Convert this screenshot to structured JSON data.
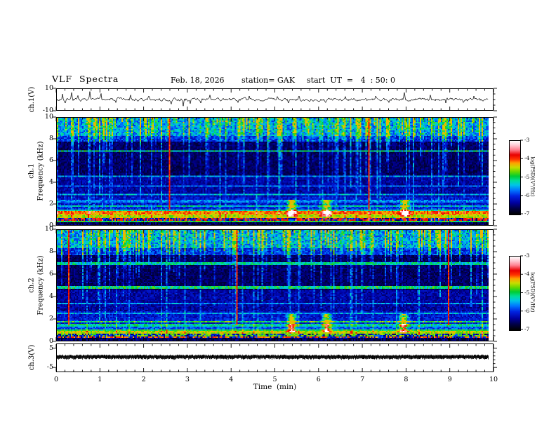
{
  "header": {
    "title": "VLF  Spectra",
    "date": "Feb. 18, 2026",
    "station": "station= GAK",
    "start_ut": "start  UT  =   4  : 50: 0"
  },
  "time_axis": {
    "label": "Time  (min)",
    "tick_labels": [
      "0",
      "1",
      "2",
      "3",
      "4",
      "5",
      "6",
      "7",
      "8",
      "9",
      "10"
    ],
    "range_min": [
      0,
      10
    ],
    "minor_step_min": 0.2
  },
  "panels": {
    "ch1_wave": {
      "ylabel": "ch.1(V)",
      "ytick_labels": [
        "10",
        "-10"
      ],
      "ytick_values": [
        10,
        -10
      ],
      "yrange": [
        -10,
        10
      ]
    },
    "ch1_spec": {
      "ylabel_lines": [
        "ch.1",
        "Frequency  (kHz)"
      ],
      "ytick_labels": [
        "10",
        "8",
        "6",
        "4",
        "2",
        "0"
      ],
      "ytick_values": [
        10,
        8,
        6,
        4,
        2,
        0
      ],
      "yrange_kHz": [
        0,
        10
      ]
    },
    "ch2_spec": {
      "ylabel_lines": [
        "ch.2",
        "Frequency  (kHz)"
      ],
      "ytick_labels": [
        "10",
        "8",
        "6",
        "4",
        "2",
        "0"
      ],
      "ytick_values": [
        10,
        8,
        6,
        4,
        2,
        0
      ],
      "yrange_kHz": [
        0,
        10
      ]
    },
    "ch3_wave": {
      "ylabel": "ch.3(V)",
      "ytick_labels": [
        "5",
        "-5"
      ],
      "ytick_values": [
        5,
        -5
      ],
      "yrange": [
        -7.5,
        7.5
      ]
    }
  },
  "colorbar": {
    "label": "log(PSD)(V²/Hz)",
    "tick_labels": [
      "-3",
      "-4",
      "-5",
      "-6",
      "-7"
    ],
    "range": [
      -3,
      -7
    ]
  },
  "accent_colors": {
    "axis": "#000000",
    "background": "#ffffff"
  },
  "palette_stops": [
    [
      0.0,
      "#000000"
    ],
    [
      0.08,
      "#000045"
    ],
    [
      0.16,
      "#0000a0"
    ],
    [
      0.25,
      "#0022e0"
    ],
    [
      0.33,
      "#0077ff"
    ],
    [
      0.4,
      "#00c4e8"
    ],
    [
      0.46,
      "#00dd99"
    ],
    [
      0.52,
      "#00cc33"
    ],
    [
      0.58,
      "#66d800"
    ],
    [
      0.64,
      "#c8dc00"
    ],
    [
      0.7,
      "#ffa000"
    ],
    [
      0.75,
      "#ff3300"
    ],
    [
      0.81,
      "#e80000"
    ],
    [
      0.88,
      "#ff8090"
    ],
    [
      0.94,
      "#ffc8d2"
    ],
    [
      1.0,
      "#ffffff"
    ]
  ],
  "chart_data": [
    {
      "id": "ch1_wave",
      "type": "line",
      "title": "ch.1 raw signal",
      "x_unit": "min",
      "x_range": [
        0,
        9.87
      ],
      "y_unit": "V",
      "y_range": [
        -10,
        10
      ],
      "description": "broadband noise about 0 V (~±2 V) with impulsive sferic spikes",
      "noise_sd_V": 1.1,
      "seed": 3,
      "spikes": [
        {
          "t": 0.13,
          "amp": 5.5
        },
        {
          "t": 0.2,
          "amp": -3.5
        },
        {
          "t": 0.33,
          "amp": 7
        },
        {
          "t": 0.48,
          "amp": 4
        },
        {
          "t": 0.75,
          "amp": 8
        },
        {
          "t": 1.02,
          "amp": 6
        },
        {
          "t": 1.35,
          "amp": -3
        },
        {
          "t": 1.68,
          "amp": 4.5
        },
        {
          "t": 2.1,
          "amp": 3.5
        },
        {
          "t": 2.62,
          "amp": -4.5
        },
        {
          "t": 2.9,
          "amp": -6.5
        },
        {
          "t": 3.05,
          "amp": -4
        },
        {
          "t": 3.3,
          "amp": -3.5
        },
        {
          "t": 3.5,
          "amp": 4.5
        },
        {
          "t": 4.15,
          "amp": -3
        },
        {
          "t": 4.4,
          "amp": 3.5
        },
        {
          "t": 5.05,
          "amp": 3
        },
        {
          "t": 5.3,
          "amp": -3.5
        },
        {
          "t": 5.55,
          "amp": 3.5
        },
        {
          "t": 6.15,
          "amp": -3
        },
        {
          "t": 6.6,
          "amp": 3
        },
        {
          "t": 7.3,
          "amp": 3.5
        },
        {
          "t": 7.6,
          "amp": -3
        },
        {
          "t": 7.95,
          "amp": 7
        },
        {
          "t": 8.55,
          "amp": 4.5
        },
        {
          "t": 8.9,
          "amp": -3.5
        },
        {
          "t": 9.3,
          "amp": -3
        },
        {
          "t": 9.55,
          "amp": 3.5
        }
      ]
    },
    {
      "id": "ch1_spec",
      "type": "heatmap",
      "title": "ch.1 VLF spectrogram",
      "x_range_min": [
        0,
        9.87
      ],
      "y_range_kHz": [
        0,
        10
      ],
      "z_label": "log(PSD)(V²/Hz)",
      "z_range": [
        -7,
        -3
      ],
      "description": "dense vertical sferic streaks (green/cyan) descending from 10 kHz over dark blue/black background; quiet dark band 4.5-8 kHz; intense red/orange/yellow hiss band 0.3-1.3 kHz; faint horizontal carrier lines",
      "seed": 7,
      "t_end": 9.87,
      "streak_probability": 0.52,
      "base_levels": [
        [
          8.4,
          10,
          0.26,
          0.22
        ],
        [
          7.8,
          8.4,
          0.17,
          0.18
        ],
        [
          4.6,
          7.8,
          0.05,
          0.11
        ],
        [
          2.6,
          4.6,
          0.1,
          0.13
        ],
        [
          1.8,
          2.6,
          0.15,
          0.14
        ],
        [
          1.45,
          1.8,
          0.17,
          0.15
        ]
      ],
      "lines_kHz": [
        [
          6.9,
          0.45
        ],
        [
          4.55,
          0.34
        ],
        [
          3.6,
          0.3
        ],
        [
          2.75,
          0.36
        ],
        [
          2.2,
          0.32
        ],
        [
          1.75,
          0.4
        ]
      ],
      "low_bands": [
        [
          1.25,
          1.45,
          0.45,
          0
        ],
        [
          1.02,
          1.25,
          0.72,
          0
        ],
        [
          0.84,
          1.02,
          0.67,
          0
        ],
        [
          0.62,
          0.84,
          0.63,
          0
        ],
        [
          0.38,
          0.62,
          0.78,
          1
        ],
        [
          0.24,
          0.38,
          0.52,
          0
        ],
        [
          0,
          0.24,
          0.1,
          0
        ]
      ],
      "red_streaks_t": [
        2.55,
        7.1
      ],
      "cyan_patches_t": [
        5.35,
        6.15,
        7.95
      ]
    },
    {
      "id": "ch2_spec",
      "type": "heatmap",
      "title": "ch.2 VLF spectrogram",
      "x_range_min": [
        0,
        9.87
      ],
      "y_range_kHz": [
        0,
        10
      ],
      "z_label": "log(PSD)(V²/Hz)",
      "z_range": [
        -7,
        -3
      ],
      "description": "same sferic streak structure as ch.1; low-frequency hiss band 0.2-1.0 kHz is green/yellow with speckled red; horizontal carrier lines near 7.0, 4.8 and 1.7 kHz",
      "seed": 13,
      "t_end": 9.87,
      "streak_probability": 0.5,
      "base_levels": [
        [
          8.4,
          10,
          0.26,
          0.22
        ],
        [
          7.8,
          8.4,
          0.17,
          0.18
        ],
        [
          4.6,
          7.8,
          0.05,
          0.11
        ],
        [
          2.6,
          4.6,
          0.1,
          0.13
        ],
        [
          1.8,
          2.6,
          0.15,
          0.14
        ],
        [
          1.45,
          1.8,
          0.17,
          0.15
        ]
      ],
      "lines_kHz": [
        [
          7.0,
          0.42
        ],
        [
          4.8,
          0.46
        ],
        [
          3.3,
          0.33
        ],
        [
          2.4,
          0.36
        ],
        [
          1.7,
          0.5
        ],
        [
          1.45,
          0.44
        ]
      ],
      "low_bands": [
        [
          1.25,
          1.45,
          0.44,
          0
        ],
        [
          1.0,
          1.25,
          0.3,
          0
        ],
        [
          0.78,
          1.0,
          0.52,
          0
        ],
        [
          0.55,
          0.78,
          0.63,
          0
        ],
        [
          0.35,
          0.55,
          0.58,
          1
        ],
        [
          0.2,
          0.35,
          0.74,
          1
        ],
        [
          0,
          0.2,
          0.1,
          0
        ]
      ],
      "red_streaks_t": [
        0.25,
        4.1,
        8.95
      ],
      "cyan_patches_t": [
        5.35,
        6.15,
        7.9
      ]
    },
    {
      "id": "ch3_wave",
      "type": "line",
      "title": "ch.3 raw signal",
      "x_unit": "min",
      "x_range": [
        0,
        9.87
      ],
      "y_unit": "V",
      "y_range": [
        -7.5,
        7.5
      ],
      "description": "constant dense trace near +0.5 V rendering as a solid black band",
      "band_center_V": 0.5,
      "band_halfwidth_V": 1.0,
      "seed": 5
    }
  ]
}
